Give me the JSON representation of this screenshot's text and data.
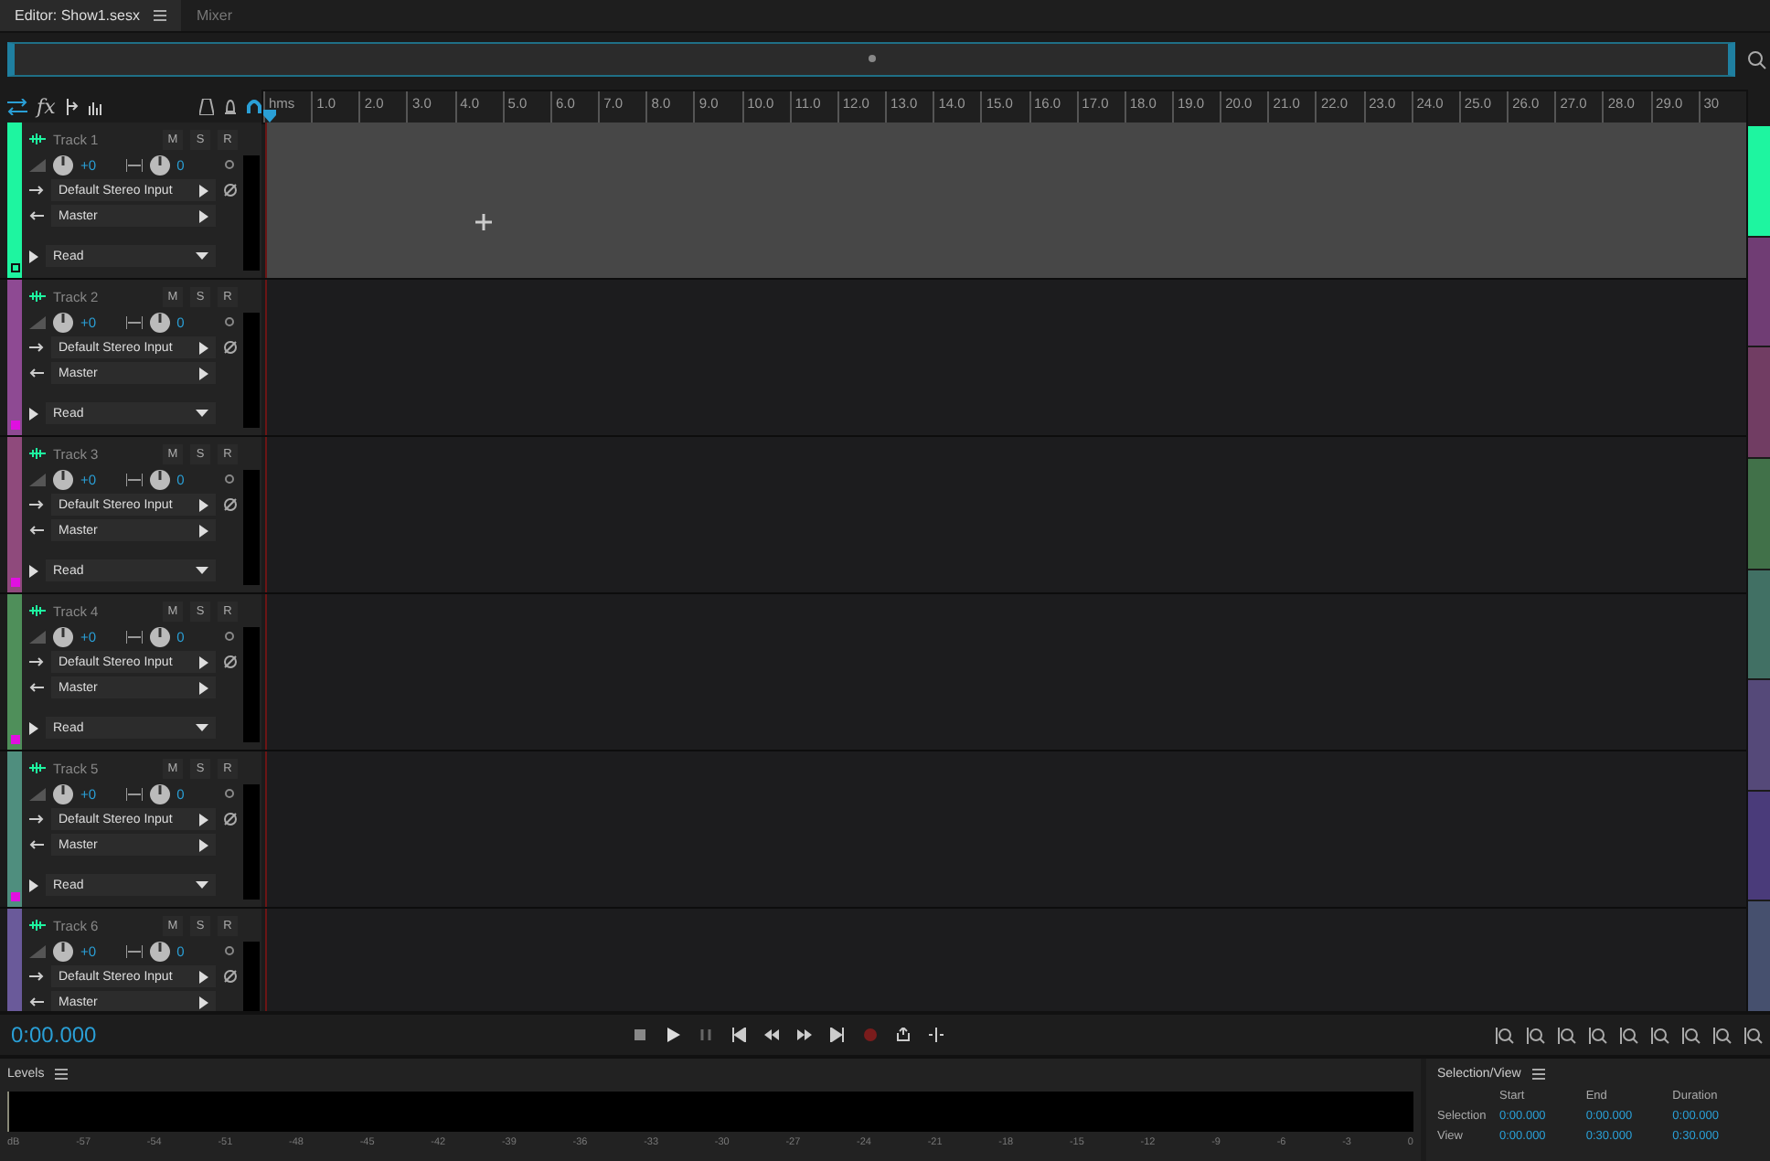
{
  "tabs": [
    {
      "label": "Editor: Show1.sesx",
      "selected": true,
      "menu": true
    },
    {
      "label": "Mixer",
      "selected": false,
      "menu": false
    }
  ],
  "toolbar": {
    "fx_label": "fx"
  },
  "ruler": {
    "labels": [
      "hms",
      "1.0",
      "2.0",
      "3.0",
      "4.0",
      "5.0",
      "6.0",
      "7.0",
      "8.0",
      "9.0",
      "10.0",
      "11.0",
      "12.0",
      "13.0",
      "14.0",
      "15.0",
      "16.0",
      "17.0",
      "18.0",
      "19.0",
      "20.0",
      "21.0",
      "22.0",
      "23.0",
      "24.0",
      "25.0",
      "26.0",
      "27.0",
      "28.0",
      "29.0",
      "30"
    ]
  },
  "tracks": [
    {
      "name": "Track 1",
      "color": "#1ef5a0",
      "selected": true,
      "buttons": [
        "M",
        "S",
        "R"
      ],
      "volume": "+0",
      "pan": "0",
      "input": "Default Stereo Input",
      "output": "Master",
      "automation": "Read"
    },
    {
      "name": "Track 2",
      "color": "#8e4a93",
      "selected": false,
      "buttons": [
        "M",
        "S",
        "R"
      ],
      "volume": "+0",
      "pan": "0",
      "input": "Default Stereo Input",
      "output": "Master",
      "automation": "Read"
    },
    {
      "name": "Track 3",
      "color": "#8f4a7c",
      "selected": false,
      "buttons": [
        "M",
        "S",
        "R"
      ],
      "volume": "+0",
      "pan": "0",
      "input": "Default Stereo Input",
      "output": "Master",
      "automation": "Read"
    },
    {
      "name": "Track 4",
      "color": "#4f8f5a",
      "selected": false,
      "buttons": [
        "M",
        "S",
        "R"
      ],
      "volume": "+0",
      "pan": "0",
      "input": "Default Stereo Input",
      "output": "Master",
      "automation": "Read"
    },
    {
      "name": "Track 5",
      "color": "#4f8e7e",
      "selected": false,
      "buttons": [
        "M",
        "S",
        "R"
      ],
      "volume": "+0",
      "pan": "0",
      "input": "Default Stereo Input",
      "output": "Master",
      "automation": "Read"
    },
    {
      "name": "Track 6",
      "color": "#6a5a9a",
      "selected": false,
      "buttons": [
        "M",
        "S",
        "R"
      ],
      "volume": "+0",
      "pan": "0",
      "input": "Default Stereo Input",
      "output": "Master"
    }
  ],
  "transport": {
    "time": "0:00.000"
  },
  "levels": {
    "title": "Levels",
    "scale": [
      "dB",
      "-57",
      "-54",
      "-51",
      "-48",
      "-45",
      "-42",
      "-39",
      "-36",
      "-33",
      "-30",
      "-27",
      "-24",
      "-21",
      "-18",
      "-15",
      "-12",
      "-9",
      "-6",
      "-3",
      "0"
    ]
  },
  "selection_view": {
    "title": "Selection/View",
    "columns": [
      "Start",
      "End",
      "Duration"
    ],
    "rows": [
      {
        "label": "Selection",
        "values": [
          "0:00.000",
          "0:00.000",
          "0:00.000"
        ]
      },
      {
        "label": "View",
        "values": [
          "0:00.000",
          "0:30.000",
          "0:30.000"
        ]
      }
    ]
  }
}
